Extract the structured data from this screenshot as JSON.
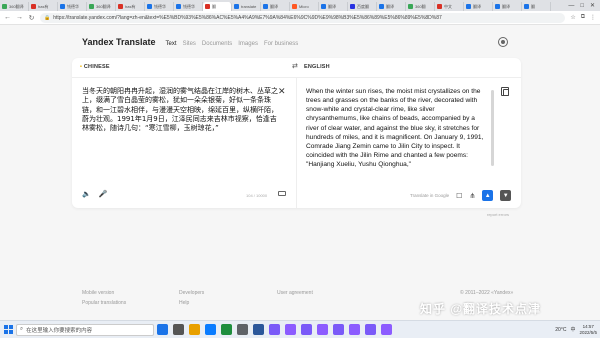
{
  "browser": {
    "tabs": [
      {
        "label": "360翻译",
        "color": "#3aa757"
      },
      {
        "label": "has有",
        "color": "#d93025"
      },
      {
        "label": "钱德华",
        "color": "#1a73e8"
      },
      {
        "label": "360翻译",
        "color": "#3aa757"
      },
      {
        "label": "has有",
        "color": "#d93025"
      },
      {
        "label": "钱德华",
        "color": "#1a73e8"
      },
      {
        "label": "钱德华",
        "color": "#1a73e8"
      },
      {
        "label": "翻",
        "color": "#d93025"
      },
      {
        "label": "translate",
        "color": "#1a73e8"
      },
      {
        "label": "翻译",
        "color": "#1a73e8"
      },
      {
        "label": "Micro",
        "color": "#ff5722"
      },
      {
        "label": "翻译",
        "color": "#1a73e8"
      },
      {
        "label": "百度翻",
        "color": "#2932e1"
      },
      {
        "label": "翻译",
        "color": "#1a73e8"
      },
      {
        "label": "360翻",
        "color": "#3aa757"
      },
      {
        "label": "中文",
        "color": "#d93025"
      },
      {
        "label": "翻译",
        "color": "#1a73e8"
      },
      {
        "label": "翻译",
        "color": "#1a73e8"
      },
      {
        "label": "翻",
        "color": "#1a73e8"
      }
    ],
    "url": "https://translate.yandex.com/?lang=zh-en&text=%E5%BD%93%E5%86%AC%E5%A4%A9%E7%9A%84%E6%9C%9D%E9%98%B3%E5%86%89%E5%86%89%E5%8D%87",
    "window_controls": [
      "—",
      "□",
      "✕"
    ]
  },
  "header": {
    "brand": "Yandex Translate",
    "nav": [
      "Text",
      "Sites",
      "Documents",
      "Images",
      "For business"
    ]
  },
  "translator": {
    "source_lang": "CHINESE",
    "target_lang": "ENGLISH",
    "source_text": "当冬天的朝阳冉冉升起，湿润的雾气结晶在江岸的树木、丛草之上，缀满了雪白晶莹的雾松，犹如一朵朵银菊，好似一条条珠链，和一江碧水相伴，与漫漫天空相映，绵延百里，纵横阡陌，蔚为壮观。1991年1月9日，江泽民同志来吉林市视察，恰逢吉林雾松，随诗几句：“寒江雪柳，玉树琼花，”",
    "char_counter": "104 / 10000",
    "translated_text": "When the winter sun rises, the moist mist crystallizes on the trees and grasses on the banks of the river, decorated with snow-white and crystal-clear rime, like silver chrysanthemums, like chains of beads, accompanied by a river of clear water, and against the blue sky, it stretches for hundreds of miles, and it is magnificent. On January 9, 1991, Comrade Jiang Zemin came to Jilin City to inspect. It coincided with the Jilin Rime and chanted a few poems: \"Hanjiang Xueliu, Yushu Qionghua,\"",
    "translate_in_google": "Translate in Google",
    "report_link": "report errors"
  },
  "footer": {
    "col1": [
      "Mobile version",
      "Popular translations"
    ],
    "col2": [
      "Developers",
      "Help"
    ],
    "col3": [
      "User agreement"
    ],
    "copyright": "© 2011–2022 «Yandex»",
    "watermark": "知乎 @翻译技术点津"
  },
  "taskbar": {
    "search_placeholder": "在这里输入你要搜索的内容",
    "apps": [
      "#1a73e8",
      "#555555",
      "#e8a000",
      "#0a7cff",
      "#1e8e3e",
      "#5f6368",
      "#2b579a",
      "#7a5af8",
      "#8c5cff",
      "#7a5af8",
      "#8c5cff",
      "#7a5af8",
      "#8c5cff",
      "#7a5af8",
      "#8c5cff"
    ],
    "weather": "20°C",
    "ime": "中",
    "time": "14:57",
    "date": "2022/5/5"
  }
}
